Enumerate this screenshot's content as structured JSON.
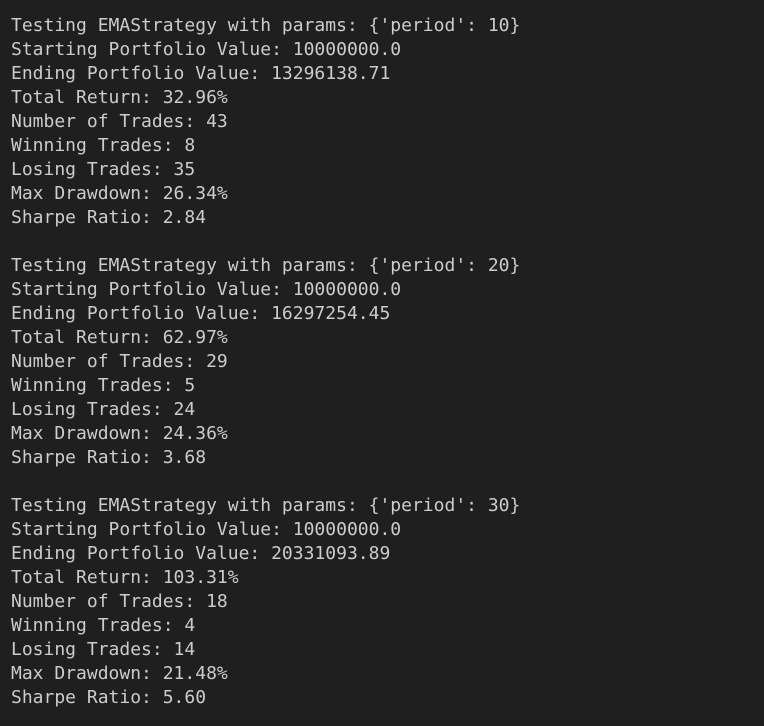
{
  "terminal": {
    "lines": [
      "Testing EMAStrategy with params: {'period': 10}",
      "Starting Portfolio Value: 10000000.0",
      "Ending Portfolio Value: 13296138.71",
      "Total Return: 32.96%",
      "Number of Trades: 43",
      "Winning Trades: 8",
      "Losing Trades: 35",
      "Max Drawdown: 26.34%",
      "Sharpe Ratio: 2.84",
      "",
      "Testing EMAStrategy with params: {'period': 20}",
      "Starting Portfolio Value: 10000000.0",
      "Ending Portfolio Value: 16297254.45",
      "Total Return: 62.97%",
      "Number of Trades: 29",
      "Winning Trades: 5",
      "Losing Trades: 24",
      "Max Drawdown: 24.36%",
      "Sharpe Ratio: 3.68",
      "",
      "Testing EMAStrategy with params: {'period': 30}",
      "Starting Portfolio Value: 10000000.0",
      "Ending Portfolio Value: 20331093.89",
      "Total Return: 103.31%",
      "Number of Trades: 18",
      "Winning Trades: 4",
      "Losing Trades: 14",
      "Max Drawdown: 21.48%",
      "Sharpe Ratio: 5.60"
    ]
  }
}
